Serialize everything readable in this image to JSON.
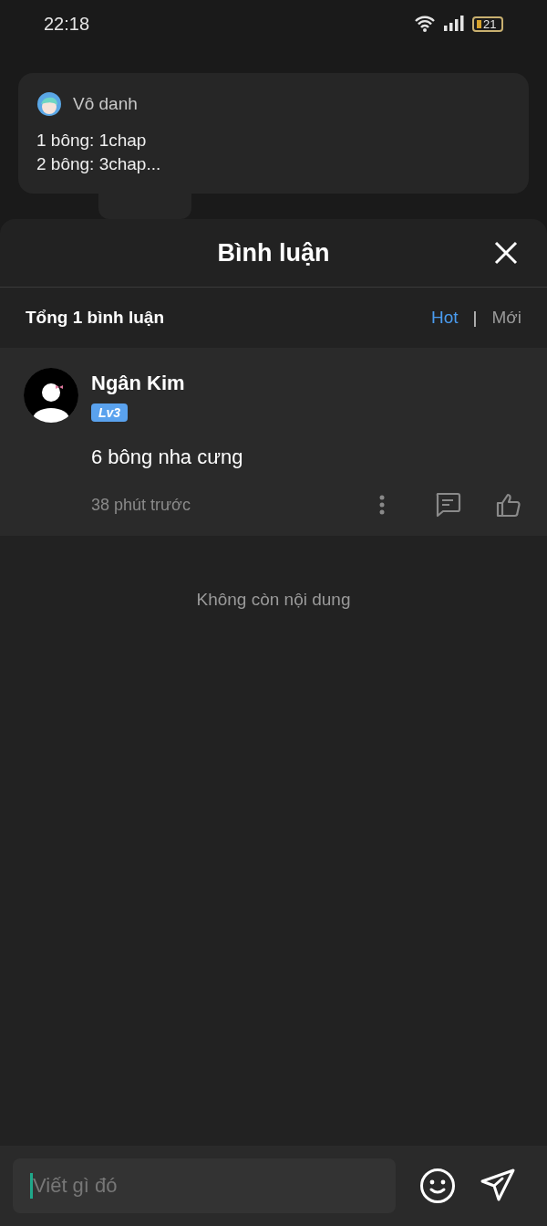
{
  "status_bar": {
    "time": "22:18",
    "battery": "21"
  },
  "notification": {
    "author": "Vô danh",
    "lines": [
      "1 bông: 1chap",
      "2 bông: 3chap..."
    ]
  },
  "sheet": {
    "title": "Bình luận",
    "total": "Tổng 1 bình luận",
    "sort_tabs": [
      {
        "label": "Hot",
        "selected": true
      },
      {
        "label": "Mới",
        "selected": false
      }
    ],
    "separator": "|"
  },
  "comments": [
    {
      "author": "Ngân Kim",
      "level_badge": "Lv3",
      "text": "6 bông nha cưng",
      "time": "38 phút trước"
    }
  ],
  "end_message": "Không còn nội dung",
  "composer": {
    "placeholder": "Viết gì đó"
  }
}
